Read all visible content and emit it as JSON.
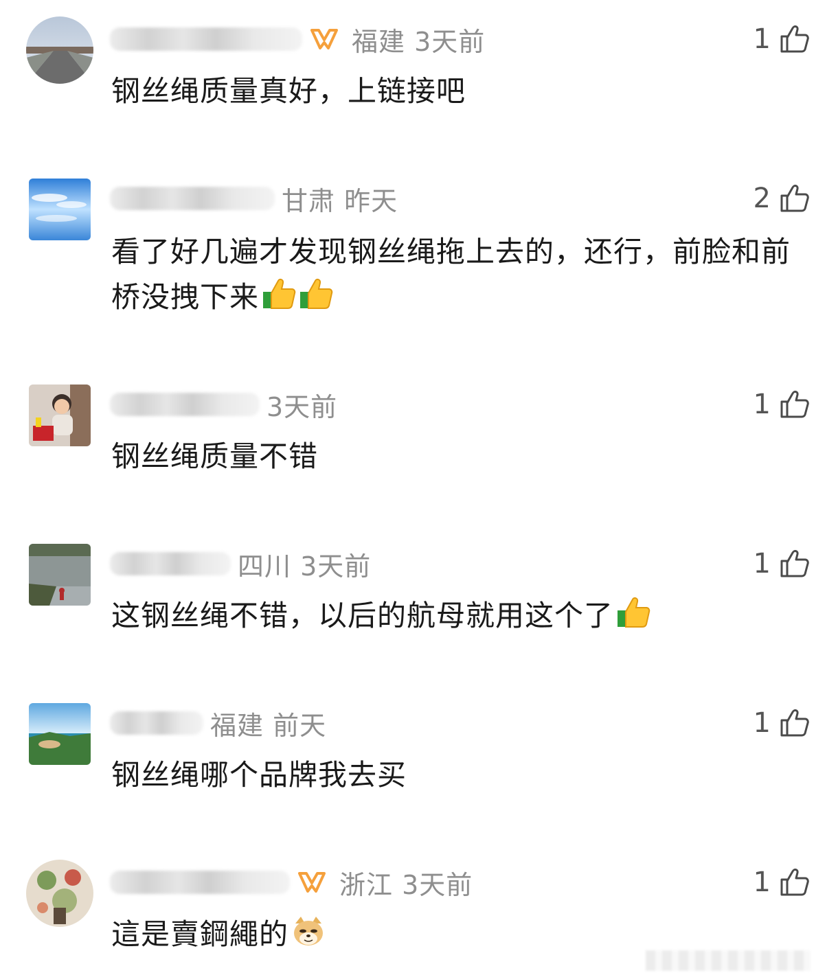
{
  "comments": [
    {
      "location_time": "福建 3天前",
      "likes": "1",
      "text": "钢丝绳质量真好，上链接吧",
      "vip": true,
      "emojis": []
    },
    {
      "location_time": "甘肃 昨天",
      "likes": "2",
      "text": "看了好几遍才发现钢丝绳拖上去的，还行，前脸和前桥没拽下来",
      "vip": false,
      "emojis": [
        "thumbs-up-emoji",
        "thumbs-up-emoji"
      ]
    },
    {
      "location_time": "3天前",
      "likes": "1",
      "text": "钢丝绳质量不错",
      "vip": false,
      "emojis": []
    },
    {
      "location_time": "四川 3天前",
      "likes": "1",
      "text": "这钢丝绳不错，以后的航母就用这个了",
      "vip": false,
      "emojis": [
        "thumbs-up-emoji"
      ]
    },
    {
      "location_time": "福建 前天",
      "likes": "1",
      "text": "钢丝绳哪个品牌我去买",
      "vip": false,
      "emojis": []
    },
    {
      "location_time": "浙江 3天前",
      "likes": "1",
      "text": "這是賣鋼繩的",
      "vip": true,
      "emojis": [
        "doge-emoji"
      ]
    }
  ],
  "colors": {
    "meta_text": "#8e8e8e",
    "body_text": "#1a1a1a",
    "vip_orange": "#f5a03c",
    "like_icon": "#4a4a4a"
  }
}
